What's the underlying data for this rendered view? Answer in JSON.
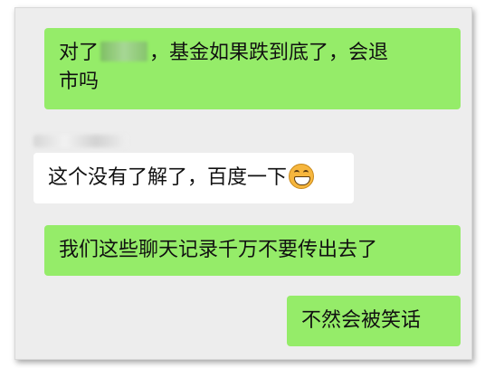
{
  "messages": [
    {
      "side": "sent",
      "line1_before": "对了",
      "line1_after": "，基金如果跌到底了，会退",
      "line2": "市吗"
    },
    {
      "side": "recv",
      "text": "这个没有了解了，百度一下",
      "emoji": "grinning-face-emoji"
    },
    {
      "side": "sent",
      "text": "我们这些聊天记录千万不要传出去了"
    },
    {
      "side": "sent",
      "text": "不然会被笑话"
    }
  ],
  "colors": {
    "sent_bubble": "#95ec69",
    "recv_bubble": "#ffffff",
    "background": "#ededed"
  }
}
